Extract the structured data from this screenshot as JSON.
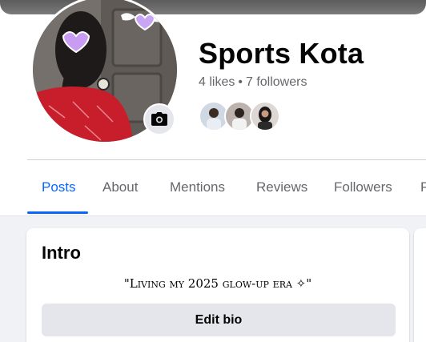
{
  "page": {
    "name": "Sports Kota",
    "likes": "4 likes",
    "separator": "•",
    "followers": "7 followers"
  },
  "icons": {
    "camera": "camera-icon"
  },
  "tabs": [
    {
      "label": "Posts",
      "active": true
    },
    {
      "label": "About",
      "active": false
    },
    {
      "label": "Mentions",
      "active": false
    },
    {
      "label": "Reviews",
      "active": false
    },
    {
      "label": "Followers",
      "active": false
    },
    {
      "label": "P",
      "active": false
    }
  ],
  "intro": {
    "title": "Intro",
    "bio": "\"Living my 2025 glow-up era ✧\"",
    "edit_bio_label": "Edit bio"
  },
  "colors": {
    "accent": "#0866ff",
    "secondary_text": "#65676b",
    "feed_background": "#f0f2f5",
    "button_gray": "#e4e6eb"
  }
}
